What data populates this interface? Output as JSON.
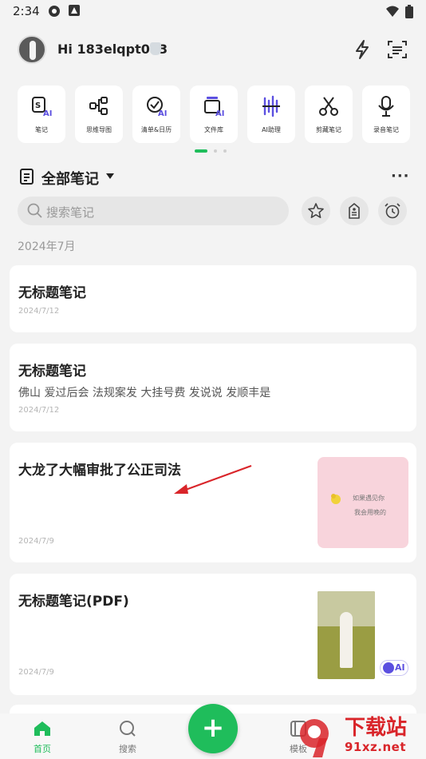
{
  "status_bar": {
    "time": "2:34"
  },
  "header": {
    "greeting": "Hi 183elqpt063"
  },
  "shortcuts": [
    {
      "label": "笔记",
      "icon": "note-ai-icon"
    },
    {
      "label": "思维导图",
      "icon": "mindmap-icon"
    },
    {
      "label": "清单&日历",
      "icon": "checklist-ai-icon"
    },
    {
      "label": "文件库",
      "icon": "filelib-ai-icon"
    },
    {
      "label": "AI助理",
      "icon": "ai-assistant-icon"
    },
    {
      "label": "剪藏笔记",
      "icon": "scissors-icon"
    },
    {
      "label": "录音笔记",
      "icon": "microphone-icon"
    }
  ],
  "section": {
    "title": "全部笔记"
  },
  "search": {
    "placeholder": "搜索笔记"
  },
  "month_header": "2024年7月",
  "notes": [
    {
      "title": "无标题笔记",
      "excerpt": "",
      "date": "2024/7/12"
    },
    {
      "title": "无标题笔记",
      "excerpt": "佛山 爱过后会 法规案发 大挂号费 发说说 发顺丰是",
      "date": "2024/7/12"
    },
    {
      "title": "大龙了大幅审批了公正司法",
      "excerpt": "",
      "date": "2024/7/9",
      "thumb_text_1": "如果遇见你",
      "thumb_text_2": "我会用晚的"
    },
    {
      "title": "无标题笔记(PDF)",
      "excerpt": "",
      "date": "2024/7/9",
      "badge": "AI"
    }
  ],
  "tabbar": {
    "home": "首页",
    "search": "搜索",
    "template": "模板"
  },
  "watermark": {
    "main": "下载站",
    "url": "91xz.net"
  },
  "colors": {
    "accent": "#1fbd5b",
    "ai_purple": "#5b4fe0",
    "arrow": "#d9252a"
  }
}
